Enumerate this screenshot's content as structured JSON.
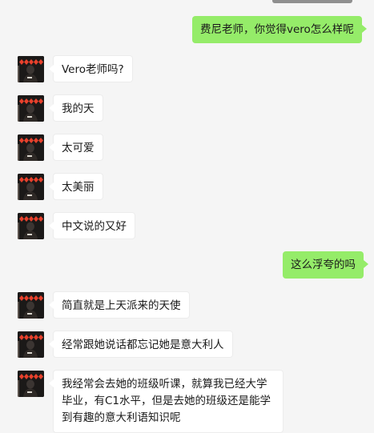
{
  "messages": [
    {
      "side": "out",
      "text": "费尼老师，你觉得vero怎么样呢"
    },
    {
      "side": "in",
      "text": "Vero老师吗?"
    },
    {
      "side": "in",
      "text": "我的天"
    },
    {
      "side": "in",
      "text": "太可爱"
    },
    {
      "side": "in",
      "text": "太美丽"
    },
    {
      "side": "in",
      "text": "中文说的又好"
    },
    {
      "side": "out",
      "text": "这么浮夸的吗"
    },
    {
      "side": "in",
      "text": "简直就是上天派来的天使"
    },
    {
      "side": "in",
      "text": "经常跟她说话都忘记她是意大利人"
    },
    {
      "side": "in",
      "lines": [
        "我经常会去她的班级听课，就算我已经大学",
        "毕业，有C1水平，但是去她的班级还是能学",
        "到有趣的意大利语知识呢"
      ]
    }
  ],
  "colors": {
    "background": "#f5f5f5",
    "incoming_bubble": "#ffffff",
    "outgoing_bubble": "#95ec69",
    "avatar_accent": "#e8412c"
  },
  "icons": {
    "avatar": "contact-avatar-icon"
  }
}
